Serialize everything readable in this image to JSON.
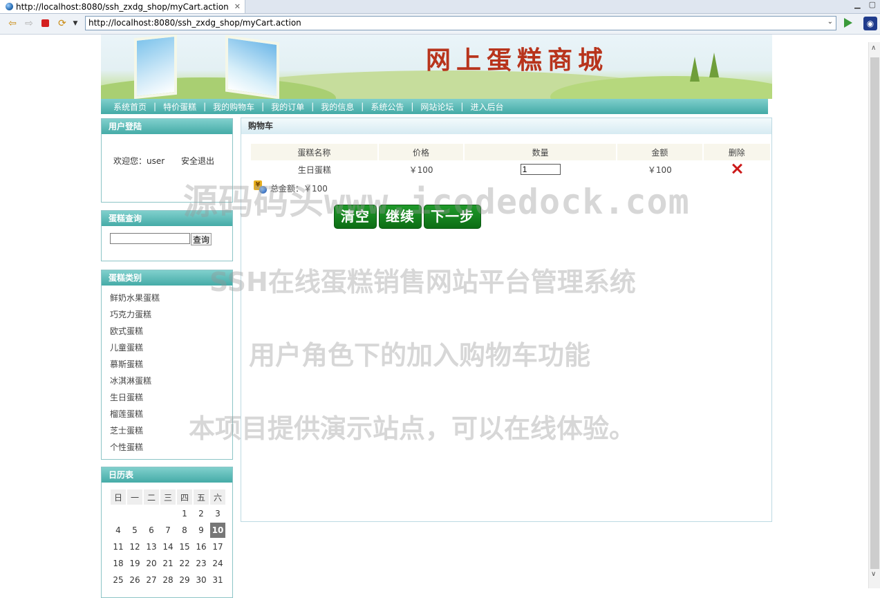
{
  "browser": {
    "tab_title": "http://localhost:8080/ssh_zxdg_shop/myCart.action",
    "url": "http://localhost:8080/ssh_zxdg_shop/myCart.action"
  },
  "banner": {
    "title": "网上蛋糕商城"
  },
  "nav": [
    "系统首页",
    "特价蛋糕",
    "我的购物车",
    "我的订单",
    "我的信息",
    "系统公告",
    "网站论坛",
    "进入后台"
  ],
  "login": {
    "title": "用户登陆",
    "welcome": "欢迎您：user",
    "logout": "安全退出"
  },
  "search": {
    "title": "蛋糕查询",
    "input_value": "",
    "button": "查询"
  },
  "categories": {
    "title": "蛋糕类别",
    "items": [
      "鲜奶水果蛋糕",
      "巧克力蛋糕",
      "欧式蛋糕",
      "儿童蛋糕",
      "慕斯蛋糕",
      "冰淇淋蛋糕",
      "生日蛋糕",
      "榴莲蛋糕",
      "芝士蛋糕",
      "个性蛋糕"
    ]
  },
  "calendar": {
    "title": "日历表",
    "weekdays": [
      "日",
      "一",
      "二",
      "三",
      "四",
      "五",
      "六"
    ],
    "weeks": [
      [
        "",
        "",
        "",
        "",
        "1",
        "2",
        "3"
      ],
      [
        "4",
        "5",
        "6",
        "7",
        "8",
        "9",
        "10"
      ],
      [
        "11",
        "12",
        "13",
        "14",
        "15",
        "16",
        "17"
      ],
      [
        "18",
        "19",
        "20",
        "21",
        "22",
        "23",
        "24"
      ],
      [
        "25",
        "26",
        "27",
        "28",
        "29",
        "30",
        "31"
      ]
    ],
    "today": "10"
  },
  "cart": {
    "title": "购物车",
    "headers": [
      "蛋糕名称",
      "价格",
      "数量",
      "金额",
      "删除"
    ],
    "rows": [
      {
        "name": "生日蛋糕",
        "price": "￥100",
        "qty": "1",
        "amount": "￥100"
      }
    ],
    "total_label": "总金额：",
    "total_value": "￥100",
    "buttons": {
      "clear": "清空",
      "continue": "继续",
      "next": "下一步"
    }
  },
  "watermarks": {
    "line1": "源码码头www.icodedock.com",
    "line2": "SSH在线蛋糕销售网站平台管理系统",
    "line3": "用户角色下的加入购物车功能",
    "line4": "本项目提供演示站点，可以在线体验。"
  }
}
